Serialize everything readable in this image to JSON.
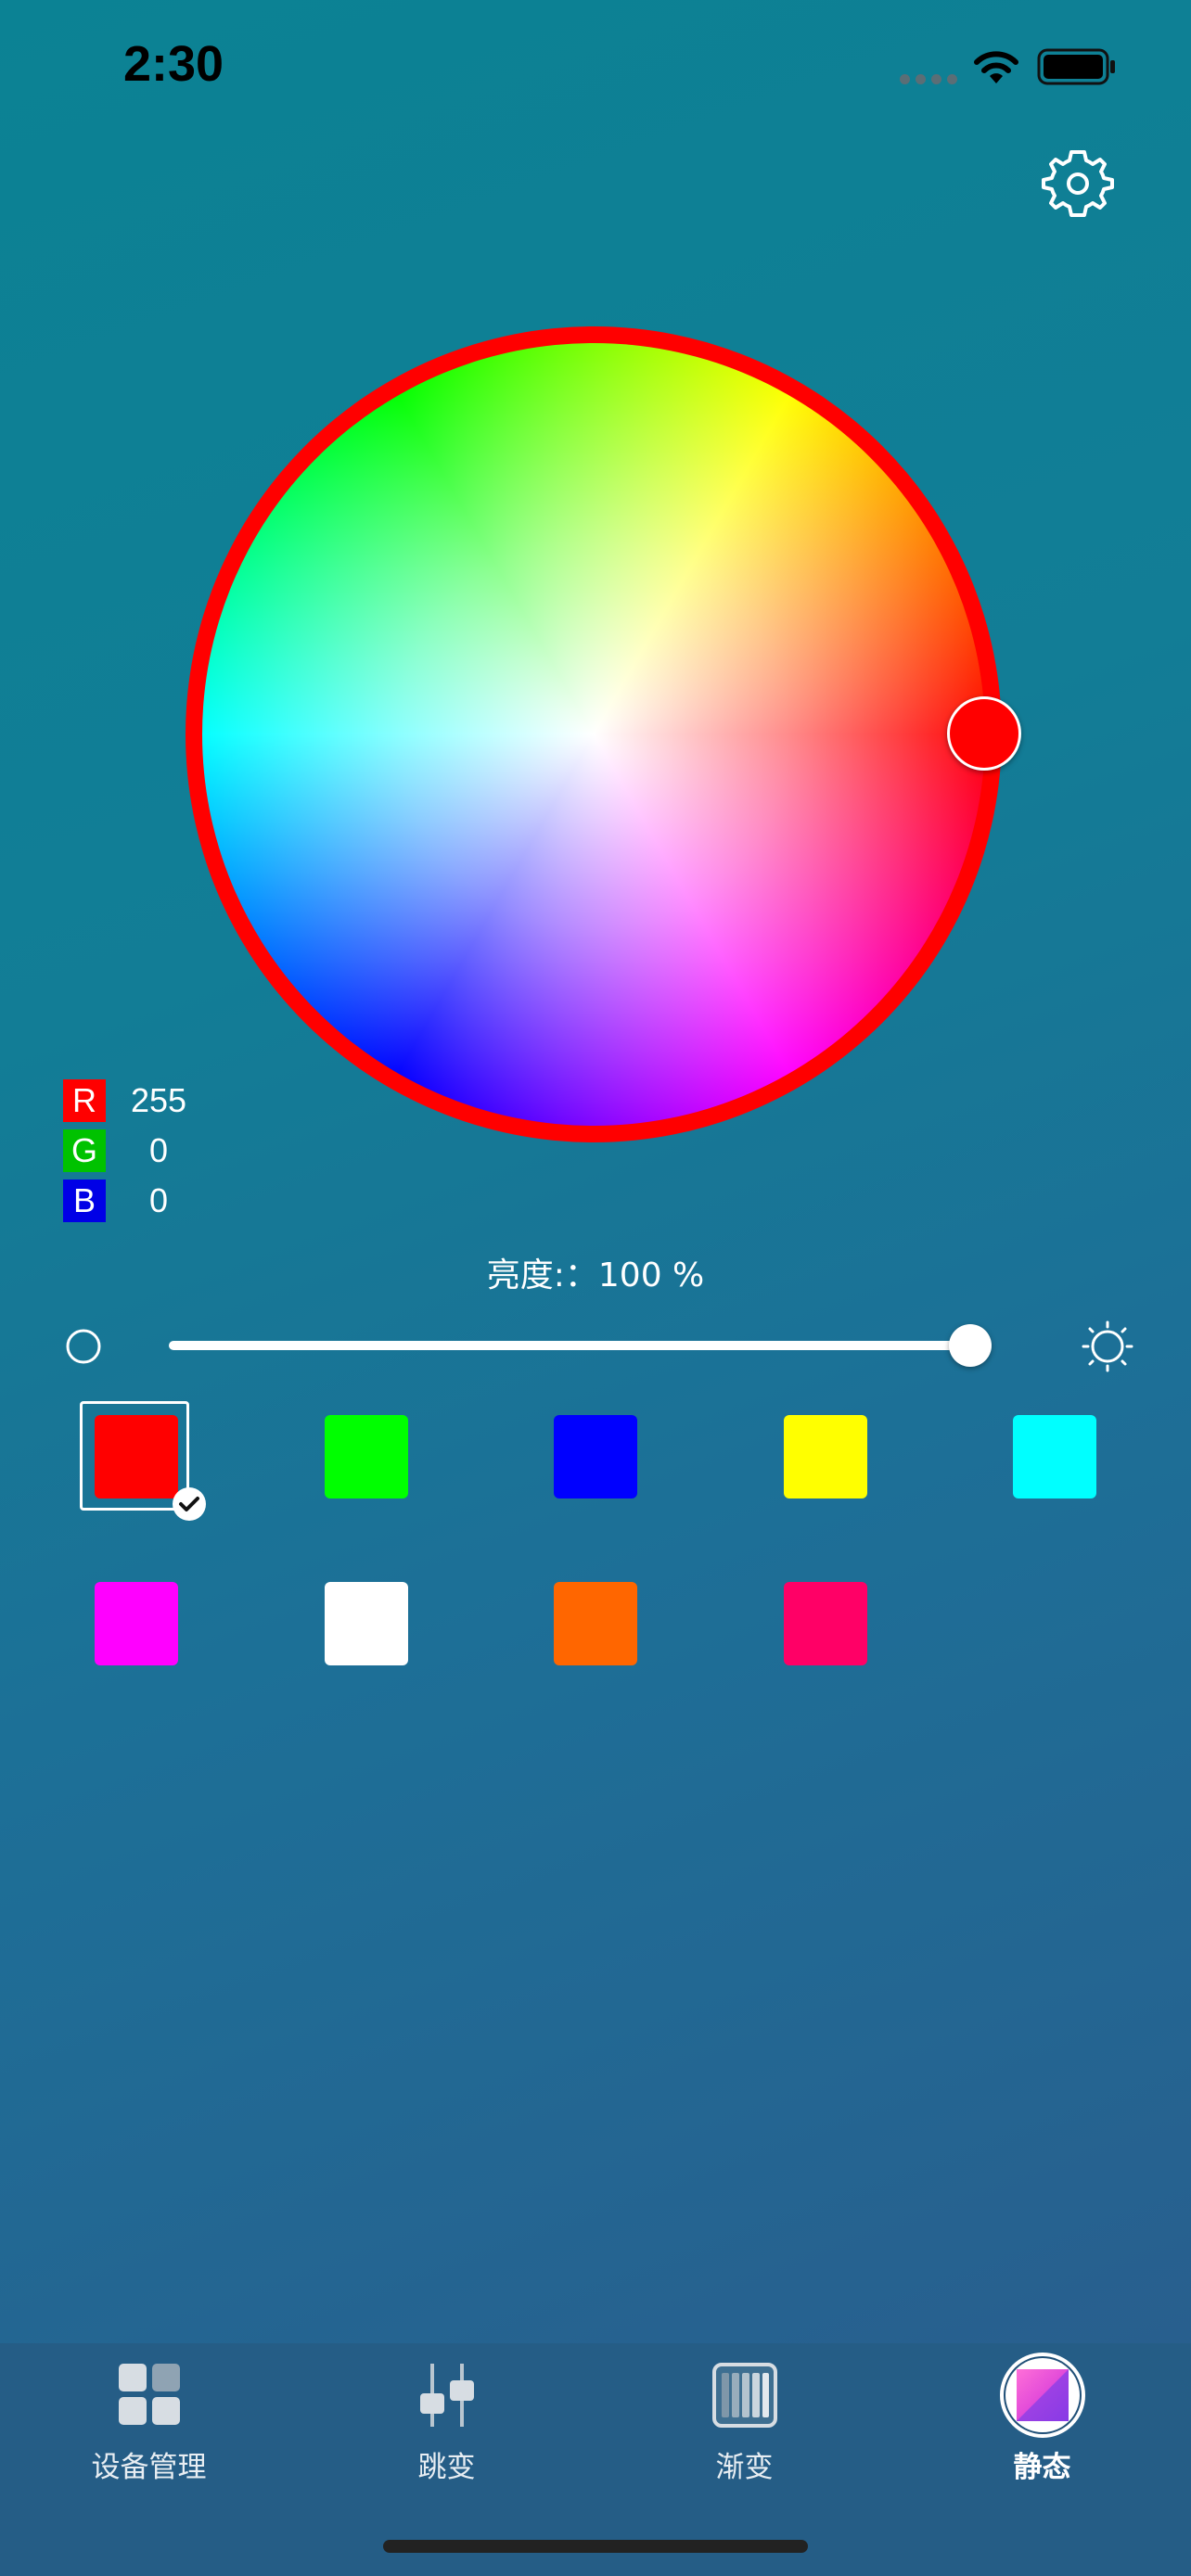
{
  "status_bar": {
    "time": "2:30"
  },
  "icons": {
    "settings": "gear-icon",
    "wifi": "wifi-icon",
    "battery": "battery-icon",
    "brightness_low": "circle-icon",
    "brightness_high": "sun-icon",
    "selected": "check-icon"
  },
  "color_picker": {
    "selected_color": "#ff0000",
    "rgb": [
      {
        "label": "R",
        "value": "255",
        "badge_color": "#ff0000"
      },
      {
        "label": "G",
        "value": "0",
        "badge_color": "#00c200"
      },
      {
        "label": "B",
        "value": "0",
        "badge_color": "#0000e6"
      }
    ]
  },
  "brightness": {
    "label": "亮度:：100 %",
    "value_percent": 100
  },
  "swatches": [
    {
      "color": "#ff0000",
      "selected": true
    },
    {
      "color": "#00ff00",
      "selected": false
    },
    {
      "color": "#0000ff",
      "selected": false
    },
    {
      "color": "#ffff00",
      "selected": false
    },
    {
      "color": "#00ffff",
      "selected": false
    },
    {
      "color": "#ff00ff",
      "selected": false
    },
    {
      "color": "#ffffff",
      "selected": false
    },
    {
      "color": "#ff6600",
      "selected": false
    },
    {
      "color": "#ff0066",
      "selected": false
    }
  ],
  "tabs": [
    {
      "label": "设备管理",
      "icon": "grid-icon",
      "active": false
    },
    {
      "label": "跳变",
      "icon": "sliders-icon",
      "active": false
    },
    {
      "label": "渐变",
      "icon": "bars-icon",
      "active": false
    },
    {
      "label": "静态",
      "icon": "static-color-icon",
      "active": true
    }
  ]
}
